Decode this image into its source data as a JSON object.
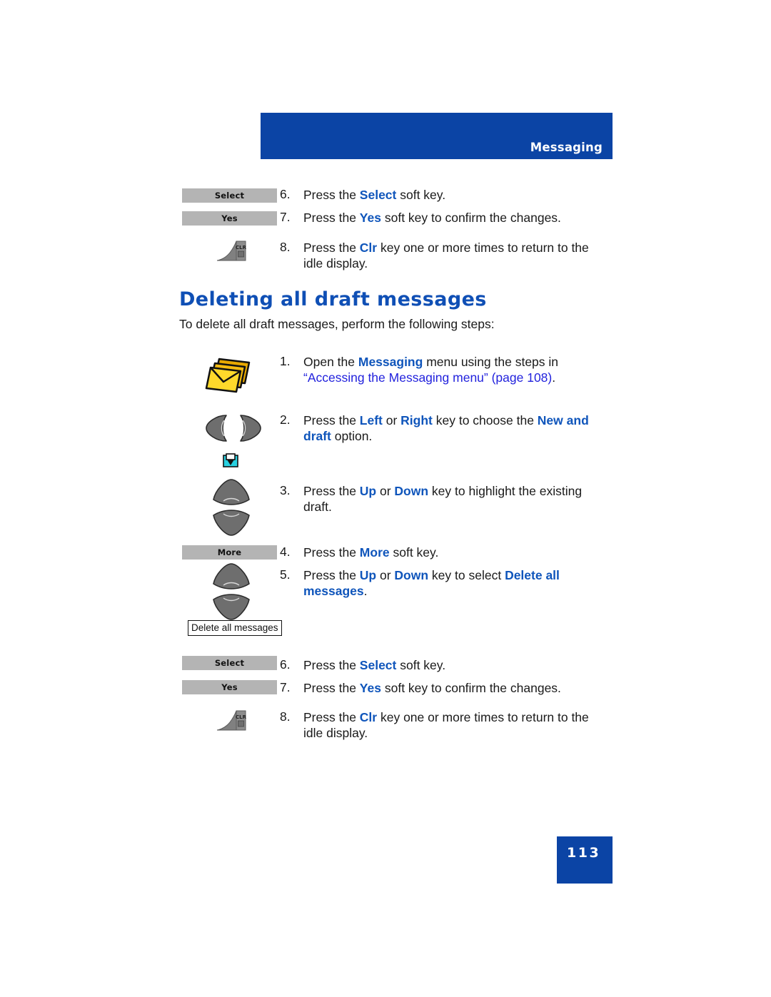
{
  "header": {
    "title": "Messaging"
  },
  "section": {
    "heading": "Deleting all draft messages",
    "intro": "To delete all draft messages, perform the following steps:"
  },
  "top_steps": [
    {
      "num": "6.",
      "softkey": "Select",
      "text_parts": [
        {
          "t": "Press the ",
          "style": "plain"
        },
        {
          "t": "Select",
          "style": "kw"
        },
        {
          "t": " soft key.",
          "style": "plain"
        }
      ]
    },
    {
      "num": "7.",
      "softkey": "Yes",
      "text_parts": [
        {
          "t": "Press the ",
          "style": "plain"
        },
        {
          "t": "Yes",
          "style": "kw"
        },
        {
          "t": " soft key to confirm the changes.",
          "style": "plain"
        }
      ]
    },
    {
      "num": "8.",
      "icon": "clr-key-icon",
      "text_parts": [
        {
          "t": "Press the ",
          "style": "plain"
        },
        {
          "t": "Clr",
          "style": "kw"
        },
        {
          "t": " key one or more times to return to the idle display.",
          "style": "plain"
        }
      ]
    }
  ],
  "main_steps": [
    {
      "num": "1.",
      "icon": "messages-envelopes-icon",
      "text_parts": [
        {
          "t": "Open the ",
          "style": "plain"
        },
        {
          "t": "Messaging",
          "style": "kw"
        },
        {
          "t": " menu using the steps in ",
          "style": "plain"
        },
        {
          "t": "“Accessing the Messaging menu” (page 108)",
          "style": "xref"
        },
        {
          "t": ".",
          "style": "plain"
        }
      ]
    },
    {
      "num": "2.",
      "icon": "left-right-nav-keys-icon",
      "text_parts": [
        {
          "t": "Press the ",
          "style": "plain"
        },
        {
          "t": "Left",
          "style": "kw"
        },
        {
          "t": " or ",
          "style": "plain"
        },
        {
          "t": "Right",
          "style": "kw"
        },
        {
          "t": " key to choose the ",
          "style": "plain"
        },
        {
          "t": "New and draft",
          "style": "kw"
        },
        {
          "t": " option.",
          "style": "plain"
        }
      ]
    },
    {
      "num": "3.",
      "icon": "up-down-nav-keys-icon",
      "text_parts": [
        {
          "t": "Press the ",
          "style": "plain"
        },
        {
          "t": "Up",
          "style": "kw"
        },
        {
          "t": " or ",
          "style": "plain"
        },
        {
          "t": "Down",
          "style": "kw"
        },
        {
          "t": " key to highlight the existing draft.",
          "style": "plain"
        }
      ]
    },
    {
      "num": "4.",
      "softkey": "More",
      "text_parts": [
        {
          "t": "Press the ",
          "style": "plain"
        },
        {
          "t": "More",
          "style": "kw"
        },
        {
          "t": " soft key.",
          "style": "plain"
        }
      ]
    },
    {
      "num": "5.",
      "icon": "up-down-nav-keys-icon",
      "text_parts": [
        {
          "t": "Press the ",
          "style": "plain"
        },
        {
          "t": "Up",
          "style": "kw"
        },
        {
          "t": " or ",
          "style": "plain"
        },
        {
          "t": "Down",
          "style": "kw"
        },
        {
          "t": " key to select ",
          "style": "plain"
        },
        {
          "t": "Delete all messages",
          "style": "kw"
        },
        {
          "t": ".",
          "style": "plain"
        }
      ]
    }
  ],
  "menu_item_box": {
    "label": "Delete all messages"
  },
  "bottom_steps": [
    {
      "num": "6.",
      "softkey": "Select",
      "text_parts": [
        {
          "t": "Press the ",
          "style": "plain"
        },
        {
          "t": "Select",
          "style": "kw"
        },
        {
          "t": " soft key.",
          "style": "plain"
        }
      ]
    },
    {
      "num": "7.",
      "softkey": "Yes",
      "text_parts": [
        {
          "t": "Press the ",
          "style": "plain"
        },
        {
          "t": "Yes",
          "style": "kw"
        },
        {
          "t": " soft key to confirm the changes.",
          "style": "plain"
        }
      ]
    },
    {
      "num": "8.",
      "icon": "clr-key-icon",
      "text_parts": [
        {
          "t": "Press the ",
          "style": "plain"
        },
        {
          "t": "Clr",
          "style": "kw"
        },
        {
          "t": " key one or more times to return to the idle display.",
          "style": "plain"
        }
      ]
    }
  ],
  "clr_key_icon": {
    "label": "CLR"
  },
  "footer": {
    "page_number": "113"
  },
  "colors": {
    "header_blue": "#0b44a5",
    "heading_blue": "#0f4fb5",
    "keyword_blue": "#0f55bb",
    "xref_blue": "#2222dd",
    "softkey_gray": "#b4b4b4",
    "body_text": "#1a1a1a"
  }
}
